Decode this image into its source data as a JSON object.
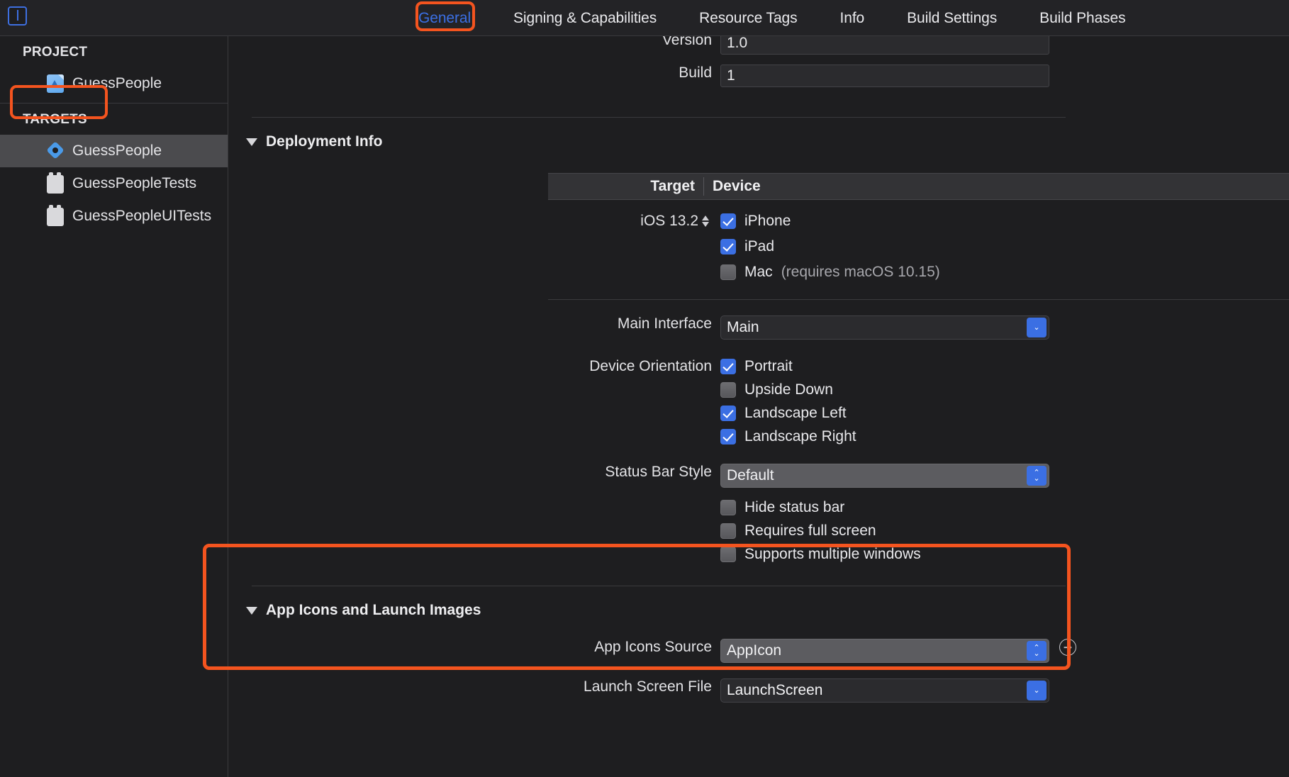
{
  "window": {
    "editor_toggle_icon": "editor-layout-icon"
  },
  "tabbar": {
    "tabs": [
      {
        "label": "General",
        "active": true
      },
      {
        "label": "Signing & Capabilities",
        "active": false
      },
      {
        "label": "Resource Tags",
        "active": false
      },
      {
        "label": "Info",
        "active": false
      },
      {
        "label": "Build Settings",
        "active": false
      },
      {
        "label": "Build Phases",
        "active": false
      }
    ]
  },
  "sidebar": {
    "project_header": "PROJECT",
    "project_items": [
      {
        "label": "GuessPeople",
        "icon": "xcodeproj-icon"
      }
    ],
    "targets_header": "TARGETS",
    "target_items": [
      {
        "label": "GuessPeople",
        "icon": "app-target-icon",
        "selected": true
      },
      {
        "label": "GuessPeopleTests",
        "icon": "test-bundle-icon",
        "selected": false
      },
      {
        "label": "GuessPeopleUITests",
        "icon": "test-bundle-icon",
        "selected": false
      }
    ]
  },
  "identity": {
    "version_label": "Version",
    "version_value": "1.0",
    "build_label": "Build",
    "build_value": "1"
  },
  "deployment": {
    "section_title": "Deployment Info",
    "table_header": {
      "target": "Target",
      "device": "Device"
    },
    "os_version": "iOS 13.2",
    "devices": [
      {
        "label": "iPhone",
        "checked": true,
        "note": ""
      },
      {
        "label": "iPad",
        "checked": true,
        "note": ""
      },
      {
        "label": "Mac",
        "checked": false,
        "note": "(requires macOS 10.15)"
      }
    ],
    "main_interface_label": "Main Interface",
    "main_interface_value": "Main",
    "device_orientation_label": "Device Orientation",
    "orientations": [
      {
        "label": "Portrait",
        "checked": true
      },
      {
        "label": "Upside Down",
        "checked": false
      },
      {
        "label": "Landscape Left",
        "checked": true
      },
      {
        "label": "Landscape Right",
        "checked": true
      }
    ],
    "status_bar_style_label": "Status Bar Style",
    "status_bar_style_value": "Default",
    "status_options": [
      {
        "label": "Hide status bar",
        "checked": false
      },
      {
        "label": "Requires full screen",
        "checked": false
      },
      {
        "label": "Supports multiple windows",
        "checked": false
      }
    ]
  },
  "app_icons": {
    "section_title": "App Icons and Launch Images",
    "app_icons_source_label": "App Icons Source",
    "app_icons_source_value": "AppIcon",
    "launch_screen_label": "Launch Screen File",
    "launch_screen_value": "LaunchScreen",
    "jump_arrow_icon": "arrow-right-circle-icon"
  },
  "highlights": {
    "accent_color": "#f4541f",
    "selected_tab_color": "#3b6fe3"
  }
}
